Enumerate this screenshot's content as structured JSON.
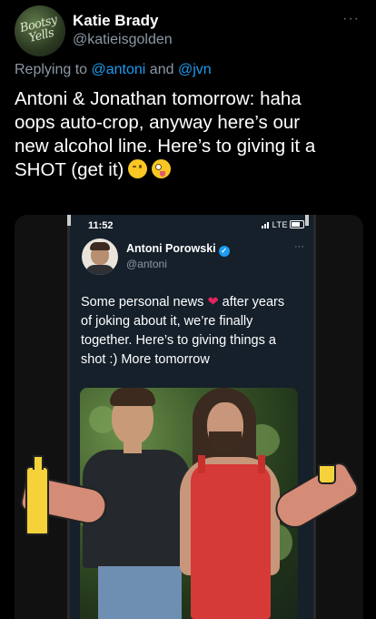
{
  "author": {
    "avatar_text": "Bootsy Yells",
    "name": "Katie Brady",
    "handle": "@katieisgolden"
  },
  "more_label": "···",
  "reply": {
    "prefix": "Replying to",
    "mention1": "@antoni",
    "conjunction": "and",
    "mention2": "@jvn"
  },
  "tweet_text": "Antoni & Jonathan tomorrow: haha\noops auto-crop, anyway here’s our\nnew alcohol line. Here’s to giving it a\nSHOT (get it)",
  "emojis": [
    "winking-face-icon",
    "zany-face-icon"
  ],
  "media": {
    "phone": {
      "time": "11:52",
      "network": "LTE",
      "quoted_tweet": {
        "name": "Antoni Porowski",
        "handle": "@antoni",
        "more_label": "···",
        "text_before_heart": "Some personal news",
        "text_after_heart": " after years of joking about it, we’re finally together. Here’s to giving things a shot :) More tomorrow"
      }
    }
  },
  "colors": {
    "background": "#000000",
    "link": "#1d9bf0",
    "muted": "#8b98a5",
    "heart": "#e0245e",
    "dress": "#d63a37",
    "drawn_bottle": "#f5d23a"
  }
}
